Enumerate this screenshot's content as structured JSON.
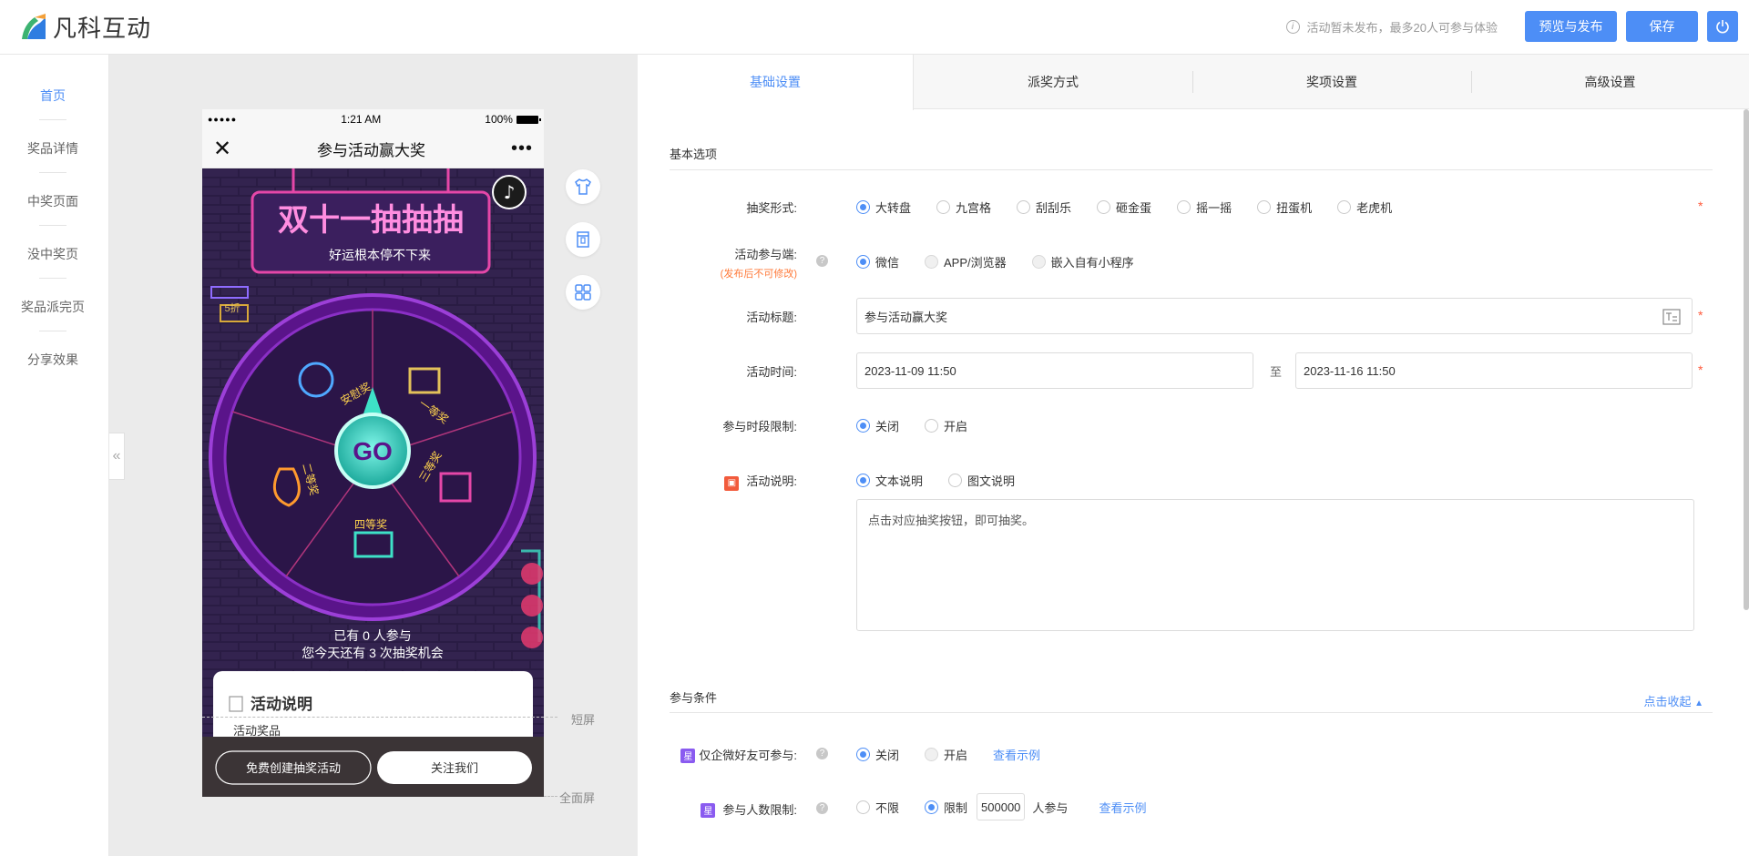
{
  "app": {
    "logo_text": "凡科互动"
  },
  "header": {
    "tip": "活动暂未发布，最多20人可参与体验",
    "preview_label": "预览与发布",
    "save_label": "保存"
  },
  "nav": {
    "items": [
      {
        "label": "首页",
        "active": true
      },
      {
        "label": "奖品详情"
      },
      {
        "label": "中奖页面"
      },
      {
        "label": "没中奖页"
      },
      {
        "label": "奖品派完页"
      },
      {
        "label": "分享效果"
      }
    ]
  },
  "phone": {
    "status_signal": "●●●●●",
    "status_time": "1:21 AM",
    "status_battery": "100%",
    "nav_title": "参与活动赢大奖",
    "banner_title": "双十一抽抽抽",
    "banner_sub": "好运根本停不下来",
    "discount_tag": "5折",
    "go_label": "GO",
    "prize_labels": [
      "安慰奖",
      "一等奖",
      "二等奖",
      "三等奖",
      "四等奖"
    ],
    "participants": "已有 0 人参与",
    "chances": "您今天还有 3 次抽奖机会",
    "desc_title": "活动说明",
    "desc_sub": "活动奖品",
    "btn_create": "免费创建抽奖活动",
    "btn_follow": "关注我们",
    "short_screen": "短屏",
    "full_screen": "全面屏"
  },
  "tabs": [
    "基础设置",
    "派奖方式",
    "奖项设置",
    "高级设置"
  ],
  "form": {
    "section_basic": "基本选项",
    "lottery_form": {
      "label": "抽奖形式:",
      "options": [
        "大转盘",
        "九宫格",
        "刮刮乐",
        "砸金蛋",
        "摇一摇",
        "扭蛋机",
        "老虎机"
      ],
      "selected": "大转盘"
    },
    "platform": {
      "label": "活动参与端:",
      "note": "(发布后不可修改)",
      "options": [
        "微信",
        "APP/浏览器",
        "嵌入自有小程序"
      ],
      "selected": "微信"
    },
    "title": {
      "label": "活动标题:",
      "value": "参与活动赢大奖"
    },
    "time": {
      "label": "活动时间:",
      "start": "2023-11-09 11:50",
      "sep": "至",
      "end": "2023-11-16 11:50"
    },
    "period": {
      "label": "参与时段限制:",
      "options": [
        "关闭",
        "开启"
      ],
      "selected": "关闭"
    },
    "desc": {
      "label": "活动说明:",
      "options": [
        "文本说明",
        "图文说明"
      ],
      "selected": "文本说明",
      "text": "点击对应抽奖按钮，即可抽奖。"
    },
    "section_cond": "参与条件",
    "collapse_label": "点击收起",
    "wecom": {
      "badge": "星",
      "label": "仅企微好友可参与:",
      "options": [
        "关闭",
        "开启"
      ],
      "selected": "关闭",
      "example": "查看示例"
    },
    "limit": {
      "badge": "星",
      "label": "参与人数限制:",
      "options": [
        "不限",
        "限制"
      ],
      "selected": "限制",
      "value": "500000",
      "unit": "人参与",
      "example": "查看示例"
    }
  },
  "colors": {
    "accent": "#4d8ef6",
    "required": "#ff5a3c",
    "wheel": "#7b1fa2"
  }
}
